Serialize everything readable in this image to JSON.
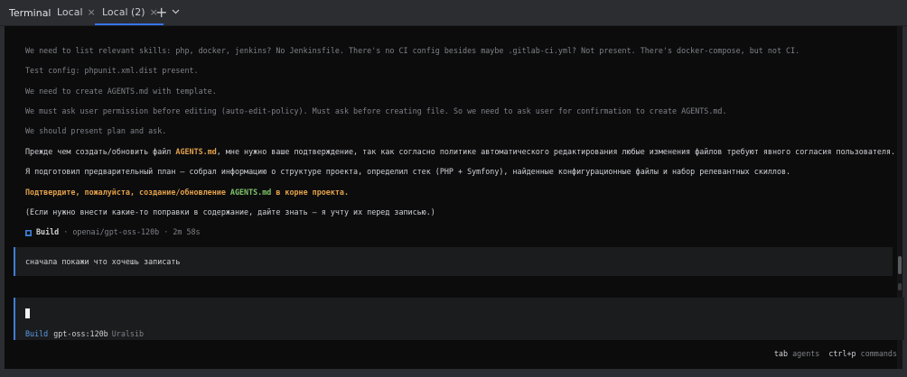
{
  "tool_window": {
    "title": "Terminal",
    "tabs": [
      {
        "label": "Local",
        "active": false
      },
      {
        "label": "Local (2)",
        "active": true
      }
    ],
    "close_glyph": "×",
    "add_glyph": "+",
    "chevron_glyph": "⌄",
    "accent_color": "#3574f0"
  },
  "transcript": {
    "lines": [
      "We need to list relevant skills: php, docker, jenkins? No Jenkinsfile. There's no CI config besides maybe .gitlab-ci.yml? Not present. There's docker-compose, but not CI.",
      "Test config: phpunit.xml.dist present.",
      "We need to create AGENTS.md with template.",
      "We must ask user permission before editing (auto-edit-policy). Must ask before creating file. So we need to ask user for confirmation to create AGENTS.md.",
      "We should present plan and ask."
    ],
    "answer": {
      "p1_before": "Прежде чем создать/обновить файл ",
      "p1_file": "AGENTS.md",
      "p1_after": ", мне нужно ваше подтверждение, так как согласно политике автоматического редактирования любые изменения файлов требуют явного согласия пользователя.",
      "p2": "Я подготовил предварительный план — собрал информацию о структуре проекта, определил стек (PHP + Symfony), найденные конфигурационные файлы и набор релевантных скиллов.",
      "p3_before": "Подтвердите, пожалуйста, создание/обновление ",
      "p3_file": "AGENTS.md",
      "p3_after": " в корне проекта.",
      "p4": "(Если нужно внести какие-то поправки в содержание, дайте знать — я учту их перед записью.)"
    },
    "build_status": {
      "icon": "build-status-icon",
      "label": "Build",
      "separator1": "·",
      "model": "openai/gpt-oss-120b",
      "separator2": "·",
      "duration": "2m 58s"
    },
    "user_message": "сначала покажи что хочешь записать"
  },
  "prompt": {
    "mode": "Build",
    "model": "gpt-oss:120b",
    "provider": "Uralsib",
    "accent_color": "#3d7fd6"
  },
  "hints": [
    {
      "key": "tab",
      "action": "agents"
    },
    {
      "key": "ctrl+p",
      "action": "commands"
    }
  ]
}
